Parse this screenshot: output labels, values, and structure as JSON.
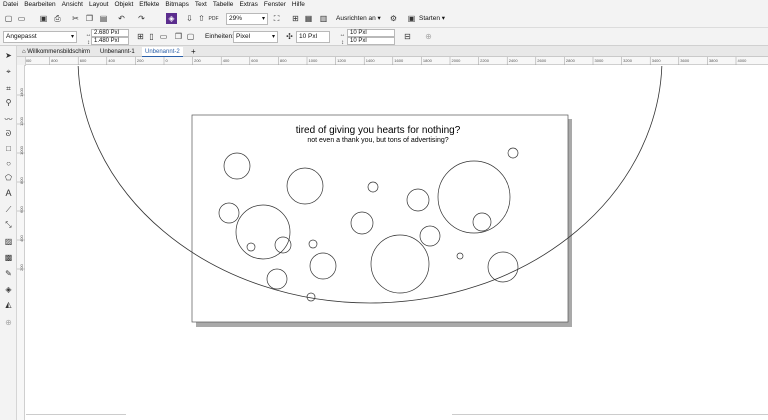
{
  "menu": [
    "Datei",
    "Bearbeiten",
    "Ansicht",
    "Layout",
    "Objekt",
    "Effekte",
    "Bitmaps",
    "Text",
    "Tabelle",
    "Extras",
    "Fenster",
    "Hilfe"
  ],
  "toolbar": {
    "zoom": "29%",
    "align_label": "Ausrichten an",
    "start_label": "Starten"
  },
  "propertybar": {
    "page_size": "Angepasst",
    "width": "2.680 Pxl",
    "height": "1.480 Pxl",
    "units_label": "Einheiten:",
    "units": "Pixel",
    "nudge": "10 Pxl",
    "dup_x": "10 Pxl",
    "dup_y": "10 Pxl"
  },
  "tabs": [
    "Willkommensbildschirm",
    "Unbenannt-1",
    "Unbenannt-2"
  ],
  "add_tab": "+",
  "ruler": {
    "h_ticks": [
      "1000",
      "800",
      "600",
      "400",
      "200",
      "0",
      "200",
      "400",
      "600",
      "800",
      "1000",
      "1200",
      "1400",
      "1600",
      "1800",
      "2000",
      "2200",
      "2400",
      "2600",
      "2800",
      "3000",
      "3200",
      "3400",
      "3600",
      "3800",
      "4000"
    ],
    "v_ticks": [
      "1400",
      "1200",
      "1000",
      "800",
      "600",
      "400",
      "200"
    ]
  },
  "page": {
    "title": "tired of giving you hearts for nothing?",
    "subtitle": "not even a thank you, but tons of advertising?"
  },
  "colors": {
    "accent": "#5b2d8e",
    "page_shadow": "#a9a9a9",
    "stroke": "#333333"
  }
}
